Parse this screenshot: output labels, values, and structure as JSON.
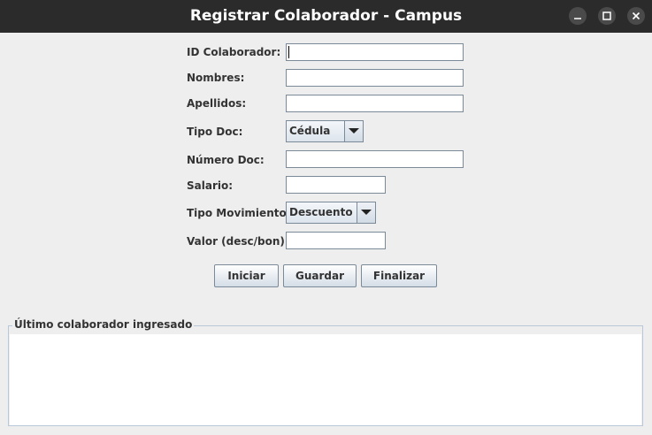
{
  "window": {
    "title": "Registrar Colaborador - Campus"
  },
  "form": {
    "id_label": "ID Colaborador:",
    "id_value": "",
    "nombres_label": "Nombres:",
    "nombres_value": "",
    "apellidos_label": "Apellidos:",
    "apellidos_value": "",
    "tipo_doc_label": "Tipo Doc:",
    "tipo_doc_selected": "Cédula",
    "numero_doc_label": "Número Doc:",
    "numero_doc_value": "",
    "salario_label": "Salario:",
    "salario_value": "",
    "tipo_mov_label": "Tipo Movimiento:",
    "tipo_mov_selected": "Descuento",
    "valor_label": "Valor (desc/bon):",
    "valor_value": ""
  },
  "buttons": {
    "iniciar": "Iniciar",
    "guardar": "Guardar",
    "finalizar": "Finalizar"
  },
  "panel": {
    "title": "Último colaborador ingresado",
    "content": ""
  },
  "icons": {
    "minimize": "minimize-icon",
    "maximize": "maximize-icon",
    "close": "close-icon",
    "dropdown": "chevron-down-icon"
  }
}
